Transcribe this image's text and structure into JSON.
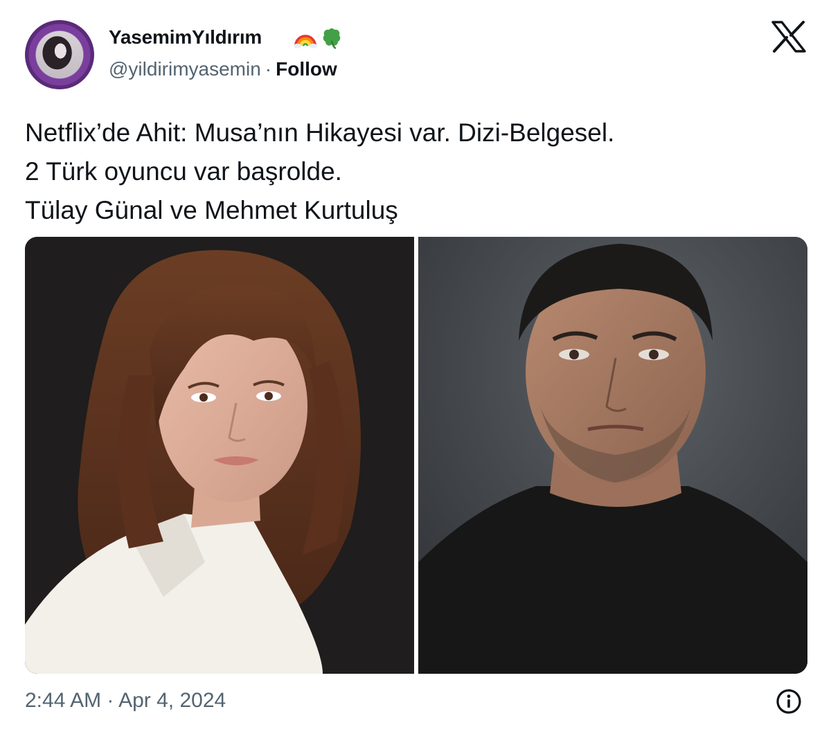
{
  "author": {
    "display_name": "YasemimYıldırım",
    "handle": "@yildirimyasemin",
    "separator": "·",
    "follow_label": "Follow",
    "name_emojis": [
      "rainbow-icon",
      "four-leaf-clover-icon"
    ]
  },
  "tweet": {
    "lines": [
      "Netflix’de Ahit: Musa’nın Hikayesi var. Dizi-Belgesel.",
      "2 Türk oyuncu var başrolde.",
      "Tülay Günal ve Mehmet Kurtuluş"
    ]
  },
  "media": {
    "images": [
      "portrait-woman-white-shirt",
      "portrait-man-black-shirt"
    ]
  },
  "footer": {
    "timestamp": "2:44 AM · Apr 4, 2024",
    "info_icon": "info-icon"
  },
  "colors": {
    "text_primary": "#0f1419",
    "text_secondary": "#536471",
    "avatar_ring": "#7a3f9d"
  }
}
